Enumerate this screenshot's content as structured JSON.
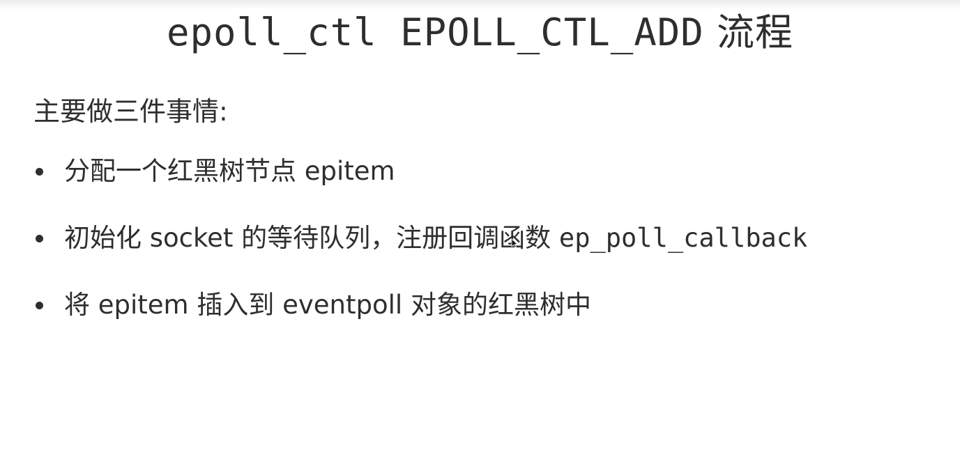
{
  "slide": {
    "title_code": "epoll_ctl EPOLL_CTL_ADD",
    "title_suffix": " 流程",
    "intro": "主要做三件事情:",
    "bullets": [
      {
        "text": "分配一个红黑树节点 epitem",
        "code": ""
      },
      {
        "text": "初始化 socket 的等待队列，注册回调函数 ",
        "code": "ep_poll_callback"
      },
      {
        "text": "将 epitem 插入到 eventpoll 对象的红黑树中",
        "code": ""
      }
    ]
  },
  "icons": {
    "cursor": "mouse-pointer-icon"
  },
  "colors": {
    "text": "#2e2e2e",
    "background": "#ffffff"
  }
}
